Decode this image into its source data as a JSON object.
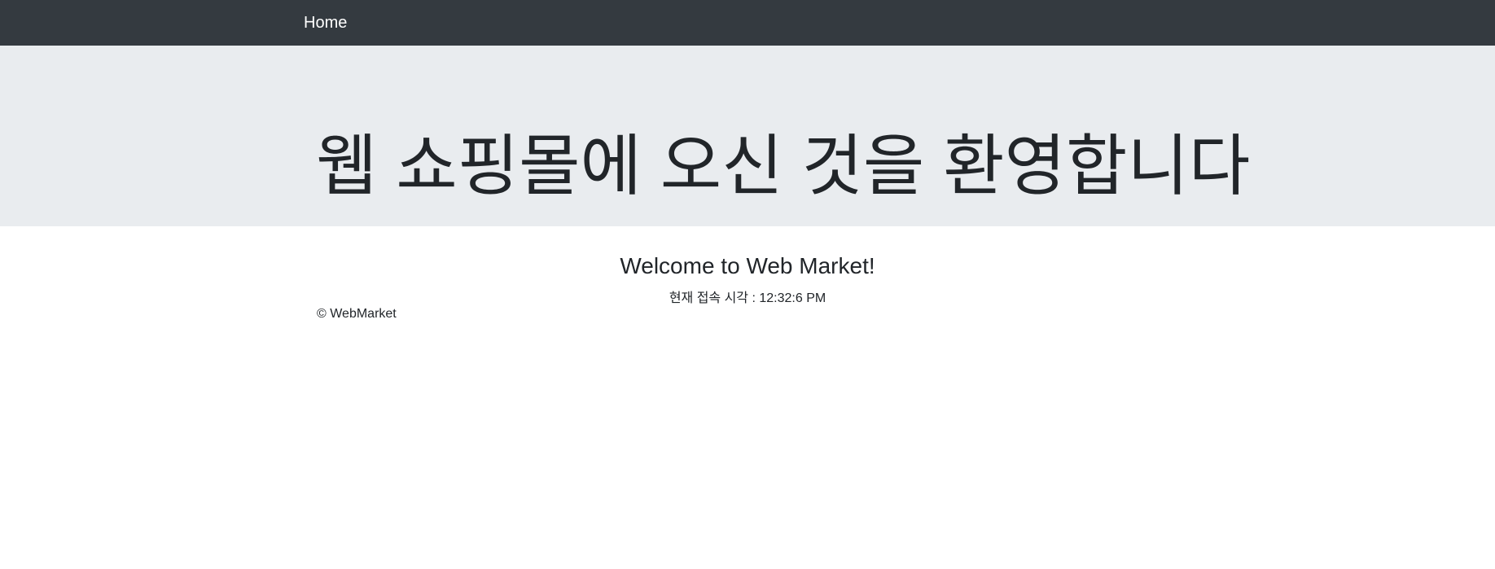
{
  "navbar": {
    "brand_label": "Home"
  },
  "jumbotron": {
    "title": "웹 쇼핑몰에 오신 것을 환영합니다"
  },
  "main": {
    "welcome": "Welcome to Web Market!",
    "time_label": "현재 접속 시각 : ",
    "time_value": "12:32:6 PM"
  },
  "footer": {
    "copyright": "© WebMarket"
  },
  "colors": {
    "navbar_bg": "#343a40",
    "jumbotron_bg": "#e9ecef",
    "text": "#212529",
    "nav_text": "#ffffff"
  }
}
